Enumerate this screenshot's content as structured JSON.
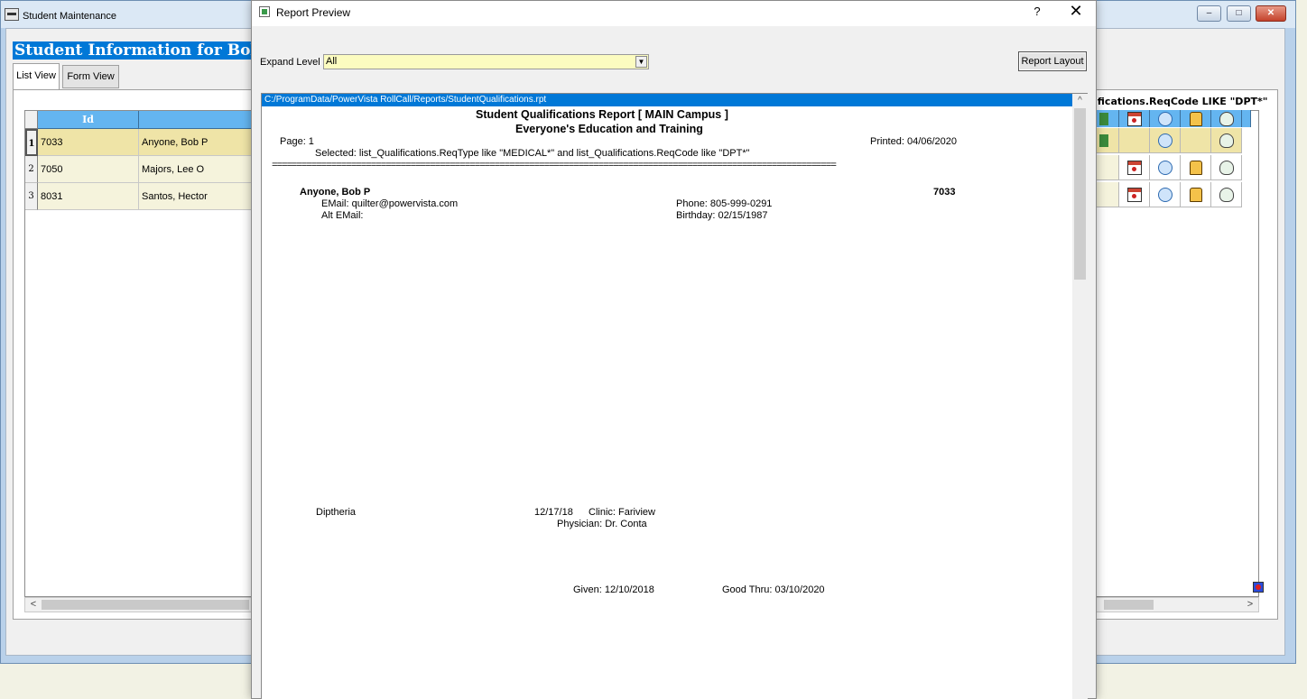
{
  "main_window": {
    "title": "Student Maintenance",
    "header": "Student Information  for Bob P A",
    "tabs": [
      "List View",
      "Form View"
    ],
    "grid": {
      "columns": [
        "Id",
        ""
      ],
      "rows": [
        {
          "num": "1",
          "id": "7033",
          "name": "Anyone, Bob P"
        },
        {
          "num": "2",
          "id": "7050",
          "name": "Majors, Lee O"
        },
        {
          "num": "3",
          "id": "8031",
          "name": "Santos, Hector"
        }
      ],
      "filter_text": "ifications.ReqCode  LIKE  \"DPT*\""
    },
    "controls": {
      "minimize": "–",
      "maximize": "□",
      "close": "✕"
    }
  },
  "dialog": {
    "title": "Report Preview",
    "help": "?",
    "close": "✕",
    "expand_label": "Expand Level",
    "expand_value": "All",
    "report_layout_button": "Report Layout",
    "report_path": "C:/ProgramData/PowerVista RollCall/Reports/StudentQualifications.rpt"
  },
  "report": {
    "title": "Student Qualifications Report   [ MAIN Campus ]",
    "subtitle": "Everyone's Education and Training",
    "page": "Page: 1",
    "printed": "Printed: 04/06/2020",
    "selected": "Selected: list_Qualifications.ReqType  like  \"MEDICAL*\"   and  list_Qualifications.ReqCode  like  \"DPT*\"",
    "rule": "==================================================================================================================",
    "student_name": "Anyone, Bob P",
    "student_id": "7033",
    "email": "EMail: quilter@powervista.com",
    "alt_email": "Alt EMail:",
    "phone": "Phone: 805-999-0291",
    "birthday": "Birthday: 02/15/1987",
    "qual_name": "Diptheria",
    "qual_date": "12/17/18",
    "clinic": "Clinic:  Fariview",
    "physician": "Physician:  Dr. Conta",
    "given": "Given: 12/10/2018",
    "good_thru": "Good Thru: 03/10/2020"
  },
  "scroll": {
    "left": "<",
    "right": ">",
    "up": "^",
    "down": "v"
  },
  "icons": [
    "calendar-icon",
    "vaccine-icon",
    "shirt-icon",
    "doctor-icon",
    "note-icon"
  ]
}
